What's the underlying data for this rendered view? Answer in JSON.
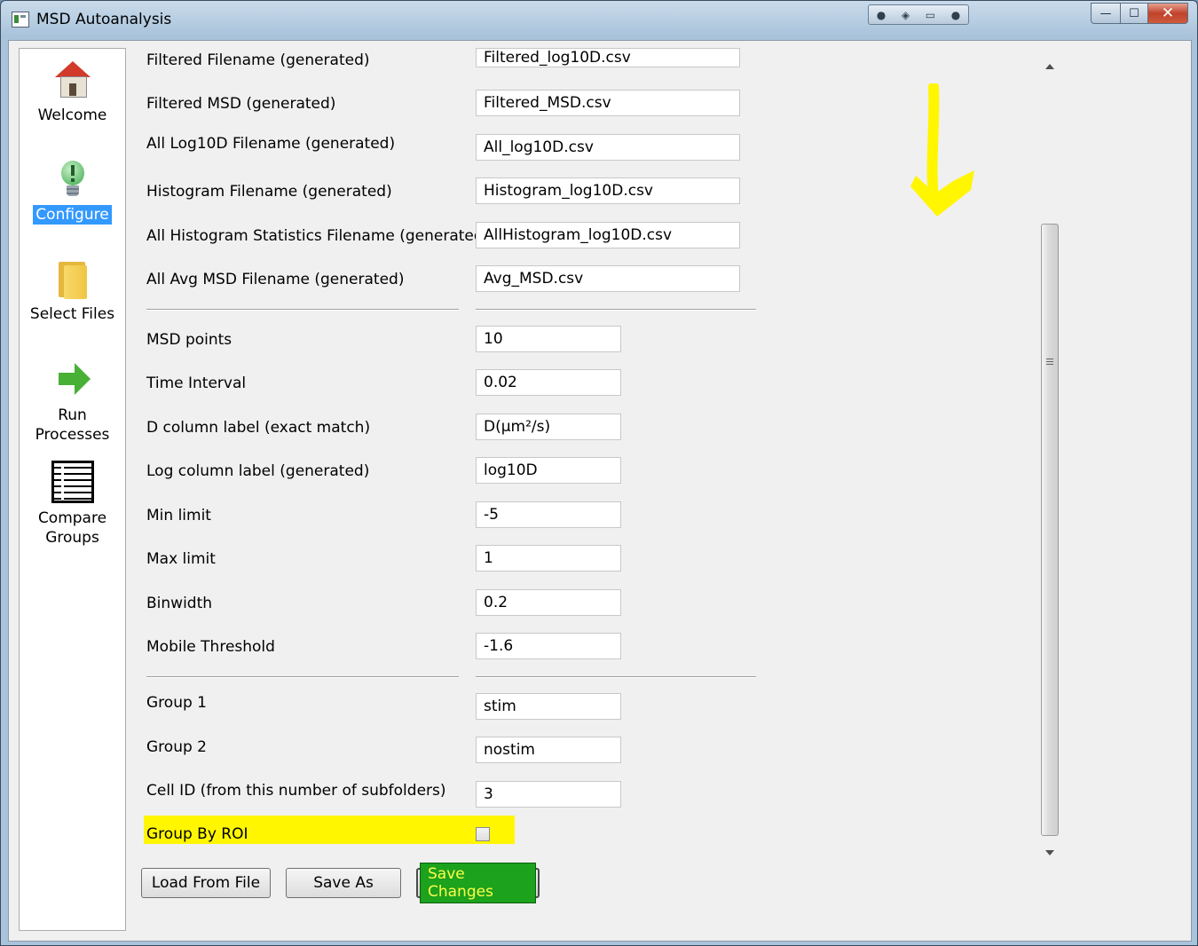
{
  "window": {
    "title": "MSD Autoanalysis",
    "controls": {
      "minimize": "—",
      "maximize": "☐",
      "close": "✕"
    }
  },
  "nav": {
    "items": [
      {
        "label": "Welcome",
        "icon": "house-icon",
        "selected": false
      },
      {
        "label": "Configure",
        "icon": "lightbulb-icon",
        "selected": true
      },
      {
        "label": "Select Files",
        "icon": "folder-icon",
        "selected": false
      },
      {
        "label": "Run\nProcesses",
        "label_line1": "Run",
        "label_line2": "Processes",
        "icon": "arrow-right-icon",
        "selected": false
      },
      {
        "label_line1": "Compare",
        "label_line2": "Groups",
        "icon": "table-icon",
        "selected": false
      }
    ]
  },
  "filenames": [
    {
      "label": "Filtered Filename (generated)",
      "value": "Filtered_log10D.csv"
    },
    {
      "label": "Filtered MSD (generated)",
      "value": "Filtered_MSD.csv"
    },
    {
      "label": "All Log10D Filename (generated)",
      "value": "All_log10D.csv"
    },
    {
      "label": "Histogram Filename (generated)",
      "value": "Histogram_log10D.csv"
    },
    {
      "label": "All Histogram Statistics Filename (generated)",
      "value": "AllHistogram_log10D.csv"
    },
    {
      "label": "All Avg MSD Filename (generated)",
      "value": "Avg_MSD.csv"
    }
  ],
  "parameters": [
    {
      "label": "MSD points",
      "value": "10"
    },
    {
      "label": "Time Interval",
      "value": "0.02"
    },
    {
      "label": "D column label (exact match)",
      "value": "D(μm²/s)"
    },
    {
      "label": "Log column label (generated)",
      "value": "log10D"
    },
    {
      "label": "Min limit",
      "value": "-5"
    },
    {
      "label": "Max limit",
      "value": "1"
    },
    {
      "label": "Binwidth",
      "value": "0.2"
    },
    {
      "label": "Mobile Threshold",
      "value": "-1.6"
    }
  ],
  "groups": [
    {
      "label": "Group 1",
      "value": "stim"
    },
    {
      "label": "Group 2",
      "value": "nostim"
    },
    {
      "label": "Cell ID (from this number of subfolders)",
      "value": "3"
    }
  ],
  "group_by_roi": {
    "label": "Group By ROI",
    "checked": false,
    "highlight_color": "#fff600"
  },
  "buttons": {
    "load": "Load From File",
    "save_as": "Save As",
    "save_changes": "Save Changes"
  },
  "colors": {
    "accent_selected": "#3399ff",
    "save_button_bg": "#1ca21c",
    "save_button_text": "#fffd4a",
    "annotation": "#fff600"
  }
}
